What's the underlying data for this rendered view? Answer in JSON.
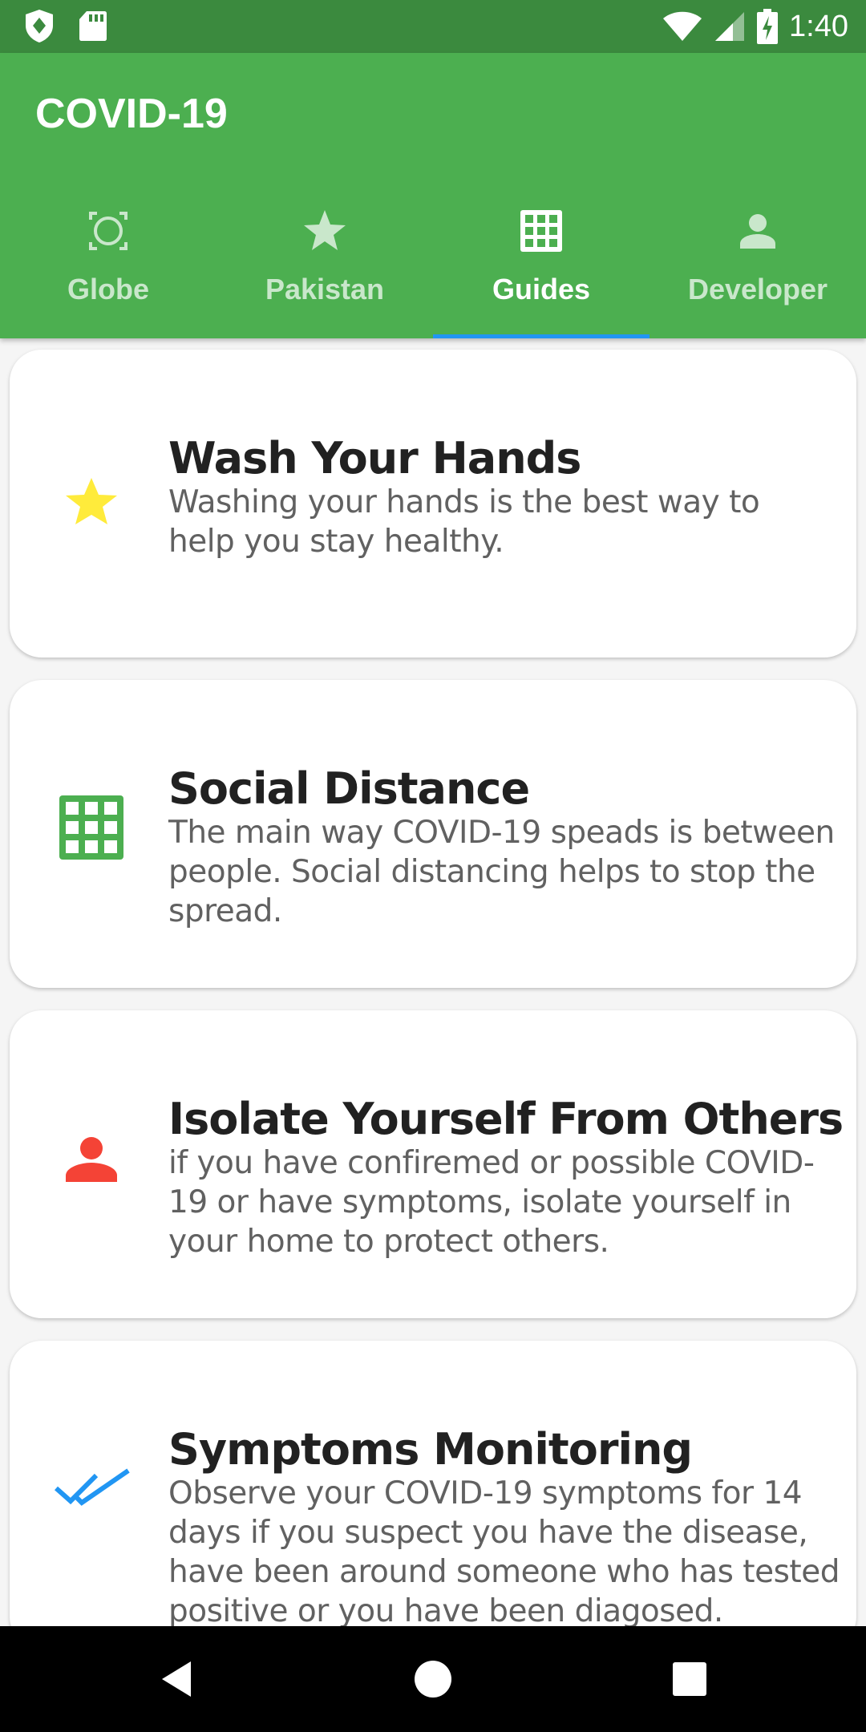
{
  "status_bar": {
    "time": "1:40",
    "icons": [
      "shield-icon",
      "sd-card-icon",
      "wifi-icon",
      "signal-icon",
      "battery-charging-icon"
    ]
  },
  "app_bar": {
    "title": "COVID-19",
    "color": "#4caf50",
    "tabs": [
      {
        "label": "Globe",
        "icon": "globe-icon",
        "active": false
      },
      {
        "label": "Pakistan",
        "icon": "star-icon",
        "active": false
      },
      {
        "label": "Guides",
        "icon": "grid-icon",
        "active": true
      },
      {
        "label": "Developer",
        "icon": "person-icon",
        "active": false
      }
    ],
    "indicator_color": "#2196f3"
  },
  "guides": [
    {
      "title": "Wash Your Hands",
      "description": "Washing your hands is the best way to\n help you stay healthy.",
      "icon": "star-icon",
      "icon_color": "#ffeb3b"
    },
    {
      "title": "Social Distance",
      "description": "The main way COVID-19 speads is between people. Social distancing helps to stop the spread.",
      "icon": "grid-icon",
      "icon_color": "#4caf50"
    },
    {
      "title": "Isolate Yourself From Others",
      "description": "if you have confiremed or possible COVID-19 or have symptoms, isolate yourself in your home to protect others.",
      "icon": "person-icon",
      "icon_color": "#f44336"
    },
    {
      "title": "Symptoms Monitoring",
      "description": "Observe your COVID-19 symptoms for 14 days if you suspect you have the disease, have been around someone who has tested positive or you have been diagosed.",
      "icon": "double-check-icon",
      "icon_color": "#2196f3"
    }
  ],
  "nav_bar": {
    "buttons": [
      "back-icon",
      "home-icon",
      "recents-icon"
    ]
  }
}
